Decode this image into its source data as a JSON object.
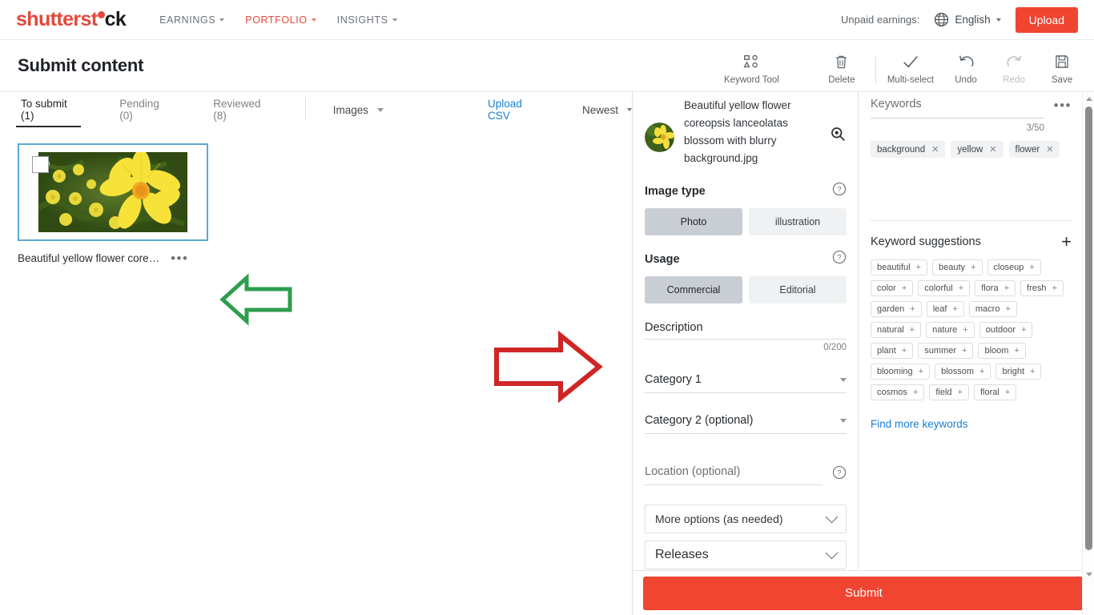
{
  "topnav": {
    "logo": {
      "part1": "shutterst",
      "part2": "ck",
      "dot_icon": "comma-dot-icon"
    },
    "links": [
      {
        "label": "EARNINGS",
        "active": false
      },
      {
        "label": "PORTFOLIO",
        "active": true
      },
      {
        "label": "INSIGHTS",
        "active": false
      }
    ],
    "unpaid_earnings_label": "Unpaid earnings:",
    "language": "English",
    "upload_label": "Upload",
    "accent_color": "#ef4531"
  },
  "subheader": {
    "title": "Submit content",
    "tools": [
      {
        "name": "keyword-tool",
        "label": "Keyword Tool",
        "disabled": false
      },
      {
        "name": "delete",
        "label": "Delete",
        "disabled": false
      },
      {
        "name": "multi-select",
        "label": "Multi-select",
        "disabled": false
      },
      {
        "name": "undo",
        "label": "Undo",
        "disabled": false
      },
      {
        "name": "redo",
        "label": "Redo",
        "disabled": true
      },
      {
        "name": "save",
        "label": "Save",
        "disabled": false
      }
    ]
  },
  "left": {
    "tabs": [
      {
        "label": "To submit (1)",
        "active": true
      },
      {
        "label": "Pending (0)",
        "active": false
      },
      {
        "label": "Reviewed (8)",
        "active": false
      }
    ],
    "filter_label": "Images",
    "upload_csv_label": "Upload CSV",
    "sort_label": "Newest",
    "card": {
      "caption": "Beautiful yellow flower core…",
      "menu_icon": "kebab-menu-icon",
      "checkbox_checked": false,
      "thumbnail_alt": "yellow-coreopsis-flower-thumbnail"
    }
  },
  "annotations": [
    {
      "name": "green-left-arrow",
      "color": "#2e9e4e",
      "direction": "left"
    },
    {
      "name": "red-right-arrow",
      "color": "#cf2525",
      "direction": "right"
    }
  ],
  "middle": {
    "file_name": "Beautiful yellow flower coreopsis lanceolatas blossom with blurry background.jpg",
    "zoom_icon": "magnifier-icon",
    "image_type": {
      "label": "Image type",
      "options": [
        {
          "label": "Photo",
          "selected": true
        },
        {
          "label": "illustration",
          "selected": false
        }
      ]
    },
    "usage": {
      "label": "Usage",
      "options": [
        {
          "label": "Commercial",
          "selected": true
        },
        {
          "label": "Editorial",
          "selected": false
        }
      ]
    },
    "description": {
      "placeholder": "Description",
      "value": "",
      "counter": "0/200"
    },
    "category1": {
      "label": "Category 1",
      "value": ""
    },
    "category2": {
      "label": "Category 2 (optional)",
      "value": ""
    },
    "location": {
      "placeholder": "Location (optional)",
      "value": ""
    },
    "more_options_label": "More options (as needed)",
    "releases_label": "Releases",
    "help_icon": "question-circle-icon"
  },
  "right": {
    "keywords_placeholder": "Keywords",
    "keywords_value": "",
    "menu_icon": "kebab-menu-icon",
    "counter": "3/50",
    "keywords": [
      "background",
      "yellow",
      "flower"
    ],
    "suggestions_title": "Keyword suggestions",
    "add_all_icon": "plus-icon",
    "suggestions": [
      "beautiful",
      "beauty",
      "closeup",
      "color",
      "colorful",
      "flora",
      "fresh",
      "garden",
      "leaf",
      "macro",
      "natural",
      "nature",
      "outdoor",
      "plant",
      "summer",
      "bloom",
      "blooming",
      "blossom",
      "bright",
      "cosmos",
      "field",
      "floral"
    ],
    "find_more_label": "Find more keywords",
    "link_color": "#1a7fd4"
  },
  "bottom": {
    "submit_label": "Submit"
  }
}
